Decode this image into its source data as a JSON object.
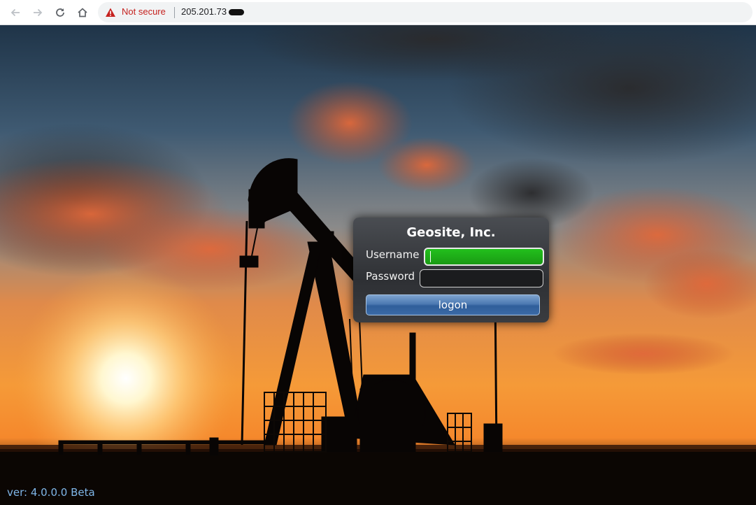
{
  "browser": {
    "security_text": "Not secure",
    "url": "205.201.73",
    "icons": {
      "back": "arrow-left-icon",
      "forward": "arrow-right-icon",
      "reload": "reload-icon",
      "home": "home-icon",
      "security": "warning-triangle-icon"
    }
  },
  "login": {
    "title": "Geosite, Inc.",
    "username_label": "Username",
    "username_value": "",
    "password_label": "Password",
    "password_value": "",
    "submit_label": "logon"
  },
  "footer": {
    "version": "ver: 4.0.0.0 Beta"
  },
  "colors": {
    "username_focus": "#22c01c",
    "button": "#4c79b2",
    "version_text": "#7fb6e8",
    "not_secure": "#c5221f"
  }
}
